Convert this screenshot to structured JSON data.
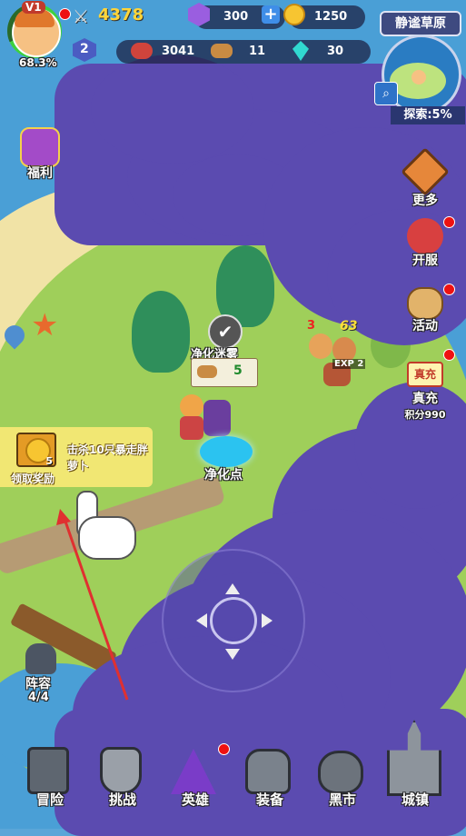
{
  "player": {
    "level": "V1",
    "exp_percent": "68.3%",
    "rank": "2"
  },
  "resources": {
    "power": "4378",
    "gems": "300",
    "gold": "1250",
    "meat": "3041",
    "wood": "11",
    "crystal": "30"
  },
  "map": {
    "region": "静谧草原",
    "explore": "探索:5%"
  },
  "left_menu": {
    "welfare": "福利"
  },
  "right_menu": {
    "more": "更多",
    "server": "开服",
    "event": "活动",
    "recharge_badge": "真充",
    "recharge": "真充",
    "points": "积分990"
  },
  "quest": {
    "count": "5",
    "text": "击杀10只暴走胖萝卜",
    "claim": "领取奖励"
  },
  "world": {
    "purify_fog_label": "净化迷雾",
    "purify_cost": "5",
    "purify_point": "净化点",
    "enemy_level_1": "3",
    "enemy_level_2": "63",
    "exp_label": "EXP 2"
  },
  "team": {
    "label": "阵容",
    "count": "4/4"
  },
  "bottom_nav": [
    "冒险",
    "挑战",
    "英雄",
    "装备",
    "黑市",
    "城镇"
  ],
  "colors": {
    "fog": "#5b4bb0",
    "gold": "#ffd53a",
    "grass": "#9fcf5a",
    "sea": "#4a9fd6"
  }
}
